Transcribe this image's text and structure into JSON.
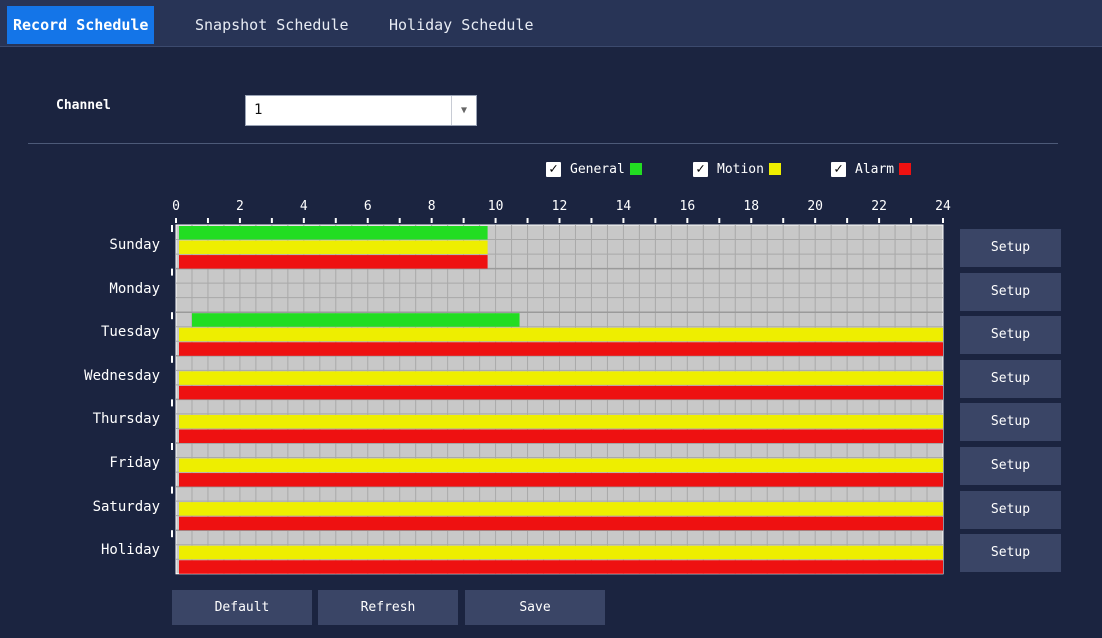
{
  "tabs": [
    {
      "label": "Record Schedule",
      "active": true
    },
    {
      "label": "Snapshot Schedule",
      "active": false
    },
    {
      "label": "Holiday Schedule",
      "active": false
    }
  ],
  "channel": {
    "label": "Channel",
    "value": "1"
  },
  "legend": [
    {
      "label": "General",
      "checked": true,
      "color": "#22dd22"
    },
    {
      "label": "Motion",
      "checked": true,
      "color": "#eeee00"
    },
    {
      "label": "Alarm",
      "checked": true,
      "color": "#ee1111"
    }
  ],
  "timeline": {
    "hours_total": 24,
    "tick_labels": [
      "0",
      "2",
      "4",
      "6",
      "8",
      "10",
      "12",
      "14",
      "16",
      "18",
      "20",
      "22",
      "24"
    ]
  },
  "schedule": [
    {
      "day": "Sunday",
      "setup_label": "Setup",
      "general": [
        [
          0,
          9.75
        ]
      ],
      "motion": [
        [
          0,
          9.75
        ]
      ],
      "alarm": [
        [
          0,
          9.75
        ]
      ]
    },
    {
      "day": "Monday",
      "setup_label": "Setup",
      "general": [],
      "motion": [],
      "alarm": []
    },
    {
      "day": "Tuesday",
      "setup_label": "Setup",
      "general": [
        [
          0.5,
          10.75
        ]
      ],
      "motion": [
        [
          0,
          24
        ]
      ],
      "alarm": [
        [
          0,
          24
        ]
      ]
    },
    {
      "day": "Wednesday",
      "setup_label": "Setup",
      "general": [],
      "motion": [
        [
          0,
          24
        ]
      ],
      "alarm": [
        [
          0,
          24
        ]
      ]
    },
    {
      "day": "Thursday",
      "setup_label": "Setup",
      "general": [],
      "motion": [
        [
          0,
          24
        ]
      ],
      "alarm": [
        [
          0,
          24
        ]
      ]
    },
    {
      "day": "Friday",
      "setup_label": "Setup",
      "general": [],
      "motion": [
        [
          0,
          24
        ]
      ],
      "alarm": [
        [
          0,
          24
        ]
      ]
    },
    {
      "day": "Saturday",
      "setup_label": "Setup",
      "general": [],
      "motion": [
        [
          0,
          24
        ]
      ],
      "alarm": [
        [
          0,
          24
        ]
      ]
    },
    {
      "day": "Holiday",
      "setup_label": "Setup",
      "general": [],
      "motion": [
        [
          0,
          24
        ]
      ],
      "alarm": [
        [
          0,
          24
        ]
      ]
    }
  ],
  "buttons": {
    "default": "Default",
    "refresh": "Refresh",
    "save": "Save"
  },
  "colors": {
    "background": "#1b2440",
    "tab_active": "#1475e8",
    "grid_cell": "#c8c8c8",
    "grid_line": "#a9a9a9",
    "general": "#22dd22",
    "motion": "#eeee00",
    "alarm": "#ee1111"
  }
}
